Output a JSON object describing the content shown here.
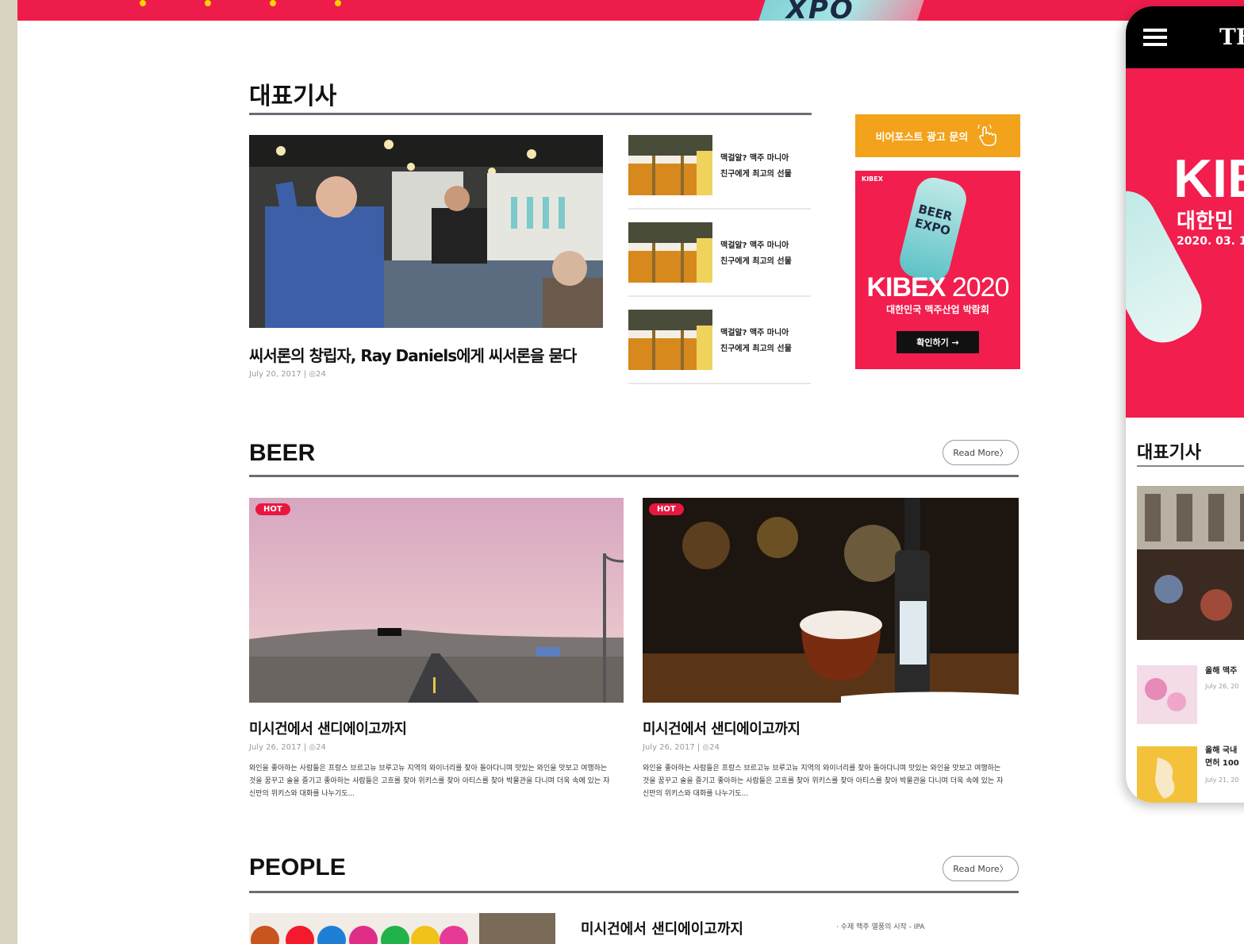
{
  "banner": {
    "logo_text": "XPO"
  },
  "featured": {
    "heading": "대표기사",
    "main": {
      "title": "씨서론의 창립자, Ray Daniels에게 씨서론을 묻다",
      "meta": "July 20, 2017  |  ◎24"
    },
    "side_items": [
      {
        "line1": "맥걸알? 맥주 마니아",
        "line2": "친구에게 최고의 선물"
      },
      {
        "line1": "맥걸알? 맥주 마니아",
        "line2": "친구에게 최고의 선물"
      },
      {
        "line1": "맥걸알? 맥주 마니아",
        "line2": "친구에게 최고의 선물"
      }
    ]
  },
  "ads": {
    "orange_label": "비어포스트 광고 문의",
    "pink": {
      "mini_logo": "KIBEX",
      "can_text": "BEER EXPO",
      "headline_bold": "KIBEX",
      "headline_year": "2020",
      "subtitle": "대한민국 맥주산업 박람회",
      "cta": "확인하기 →"
    }
  },
  "beer": {
    "heading": "BEER",
    "read_more": "Read More〉",
    "cards": [
      {
        "badge": "HOT",
        "title": "미시건에서 샌디에이고까지",
        "meta": "July 26, 2017  |  ◎24",
        "body": "와인을 좋아하는 사람들은 프랑스 브르고뉴 브루고뉴 지역의 와이너리를 찾아 돌아다니며 맛있는 와인을 맛보고 여행하는 것을 꿈꾸고 술을 즐기고 좋아하는 사람들은 고흐를 찾아 위키스를 찾아 아티스를 찾아 박물관을 다니며 더욱 속에 있는 자신만의 위키스와 대화를 나누기도..."
      },
      {
        "badge": "HOT",
        "title": "미시건에서 샌디에이고까지",
        "meta": "July 26, 2017  |  ◎24",
        "body": "와인을 좋아하는 사람들은 프랑스 브르고뉴 브루고뉴 지역의 와이너리를 찾아 돌아다니며 맛있는 와인을 맛보고 여행하는 것을 꿈꾸고 술을 즐기고 좋아하는 사람들은 고흐를 찾아 위키스를 찾아 아티스를 찾아 박물관을 다니며 더욱 속에 있는 자신만의 위키스와 대화를 나누기도..."
      }
    ]
  },
  "people": {
    "heading": "PEOPLE",
    "read_more": "Read More〉",
    "card_title": "미시건에서 샌디에이고까지",
    "note": "· 수제 맥주 열풍의 시작 - IPA"
  },
  "mobile": {
    "brand": "TH",
    "hero_big": "KIB",
    "hero_korean": "대한민",
    "hero_date": "2020. 03. 1",
    "section_heading": "대표기사",
    "items": [
      {
        "line1": "올해 맥주",
        "line2": "",
        "meta": "July 26, 20"
      },
      {
        "line1": "올해 국내",
        "line2": "면허 100",
        "meta": "July 21, 20"
      }
    ]
  },
  "colors": {
    "brand_red": "#ee1c4b",
    "ad_orange": "#f3a21b",
    "hot_badge": "#e8173f",
    "rule": "#6d6d76"
  },
  "icons": [
    "menu-icon",
    "hand-pointer-icon"
  ]
}
